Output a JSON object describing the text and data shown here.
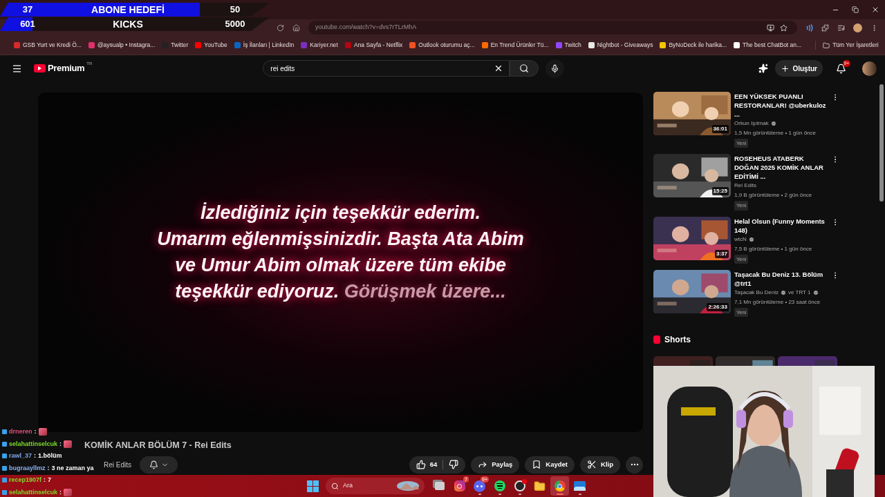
{
  "goals": [
    {
      "current": "37",
      "label": "ABONE HEDEFİ",
      "target": "50",
      "level": 0.74
    },
    {
      "current": "601",
      "label": "KICKS",
      "target": "5000",
      "level": 0.12
    }
  ],
  "address_bar": {
    "url": "youtube.com/watch?v=dvs7rTLrMhA"
  },
  "bookmarks": [
    {
      "label": "GSB Yurt ve Kredi Ö...",
      "color": "#d62b2b"
    },
    {
      "label": "@aysualp • Instagra...",
      "color": "#e1306c"
    },
    {
      "label": "Twitter",
      "color": "#222222"
    },
    {
      "label": "YouTube",
      "color": "#ff0000"
    },
    {
      "label": "İş İlanları | LinkedIn",
      "color": "#0a66c2"
    },
    {
      "label": "Kariyer.net",
      "color": "#7b2fbe"
    },
    {
      "label": "Ana Sayfa - Netflix",
      "color": "#b20710"
    },
    {
      "label": "Outlook oturumu aç...",
      "color": "#f25022"
    },
    {
      "label": "En Trend Ürünler Tü...",
      "color": "#ff6a00"
    },
    {
      "label": "Twitch",
      "color": "#9146ff"
    },
    {
      "label": "Nightbot - Giveaways",
      "color": "#e8e8e8"
    },
    {
      "label": "ByNoDeck ile harika...",
      "color": "#f5c400"
    },
    {
      "label": "The best ChatBot an...",
      "color": "#ffffff"
    }
  ],
  "all_bookmarks": "Tüm Yer İşaretleri",
  "header": {
    "logo": "Premium",
    "region": "TR",
    "search": {
      "value": "rei edits"
    },
    "create": "Oluştur",
    "notifications": "9+"
  },
  "caption": {
    "lines": [
      "İzlediğiniz için teşekkür ederim.",
      "Umarım eğlenmişsinizdir. Başta Ata Abim",
      "ve Umur Abim olmak üzere tüm ekibe"
    ],
    "last_line": "teşekkür ediyoruz.",
    "fading": "Görüşmek üzere..."
  },
  "video": {
    "title": "KOMİK ANLAR BÖLÜM 7 - Rei Edits",
    "channel": "Rei Edits",
    "likes": "64",
    "actions": [
      "Paylaş",
      "Kaydet",
      "Klip"
    ]
  },
  "recommendations": [
    {
      "title": "EEN YÜKSEK PUANLI RESTORANLAR! @uberkuloz ...",
      "channels": [
        {
          "name": "Orkun Işıtmak",
          "verified": true
        }
      ],
      "meta": "1,5 Mn görüntüleme • 1 gün önce",
      "badge": "Yeni",
      "duration": "36:01"
    },
    {
      "title": "ROSEHEUS ATABERK DOĞAN 2025 KOMİK ANLAR EDİTİMİ ...",
      "channels": [
        {
          "name": "Rei Edits",
          "verified": false
        }
      ],
      "meta": "1,9 B görüntüleme • 2 gün önce",
      "badge": "Yeni",
      "duration": "15:25"
    },
    {
      "title": "Helal Olsun (Funny Moments 148)",
      "channels": [
        {
          "name": "wtcN",
          "verified": true
        }
      ],
      "meta": "7,5 B görüntüleme • 1 gün önce",
      "badge": "Yeni",
      "duration": "3:37"
    },
    {
      "title": "Taşacak Bu Deniz 13. Bölüm @trt1",
      "channels": [
        {
          "name": "Taşacak Bu Deniz",
          "verified": true
        },
        {
          "name": "ve TRT 1",
          "verified": true
        }
      ],
      "meta": "7,1 Mn görüntüleme • 23 saat önce",
      "badge": "Yeni",
      "duration": "2:26:33"
    }
  ],
  "shorts": {
    "title": "Shorts"
  },
  "chat_separator": ":",
  "chat": [
    {
      "user": "drneren",
      "color": "#e0507a",
      "kind": "emote"
    },
    {
      "user": "selahattinselcuk",
      "color": "#7ddc2a",
      "kind": "emote"
    },
    {
      "user": "rawl_37",
      "color": "#7fa6e8",
      "kind": "text",
      "text": "1.bölüm"
    },
    {
      "user": "bugraayllmz",
      "color": "#8ab0f0",
      "kind": "text",
      "text": "3 ne zaman ya"
    },
    {
      "user": "recep1907f",
      "color": "#7ddc2a",
      "kind": "text",
      "text": "7"
    },
    {
      "user": "selahattinselcuk",
      "color": "#7ddc2a",
      "kind": "emote"
    }
  ],
  "taskbar": {
    "search": "Ara",
    "apps": [
      {
        "kind": "task-view",
        "open": false,
        "selected": false
      },
      {
        "kind": "instagram",
        "badge": "7",
        "open": false,
        "selected": false
      },
      {
        "kind": "discord",
        "badge": "9+",
        "open": true,
        "selected": false
      },
      {
        "kind": "spotify",
        "open": true,
        "selected": false
      },
      {
        "kind": "obs",
        "open": true,
        "selected": false
      },
      {
        "kind": "folder",
        "open": false,
        "selected": false
      },
      {
        "kind": "chrome",
        "open": true,
        "selected": true
      },
      {
        "kind": "app",
        "open": true,
        "selected": false
      }
    ]
  }
}
